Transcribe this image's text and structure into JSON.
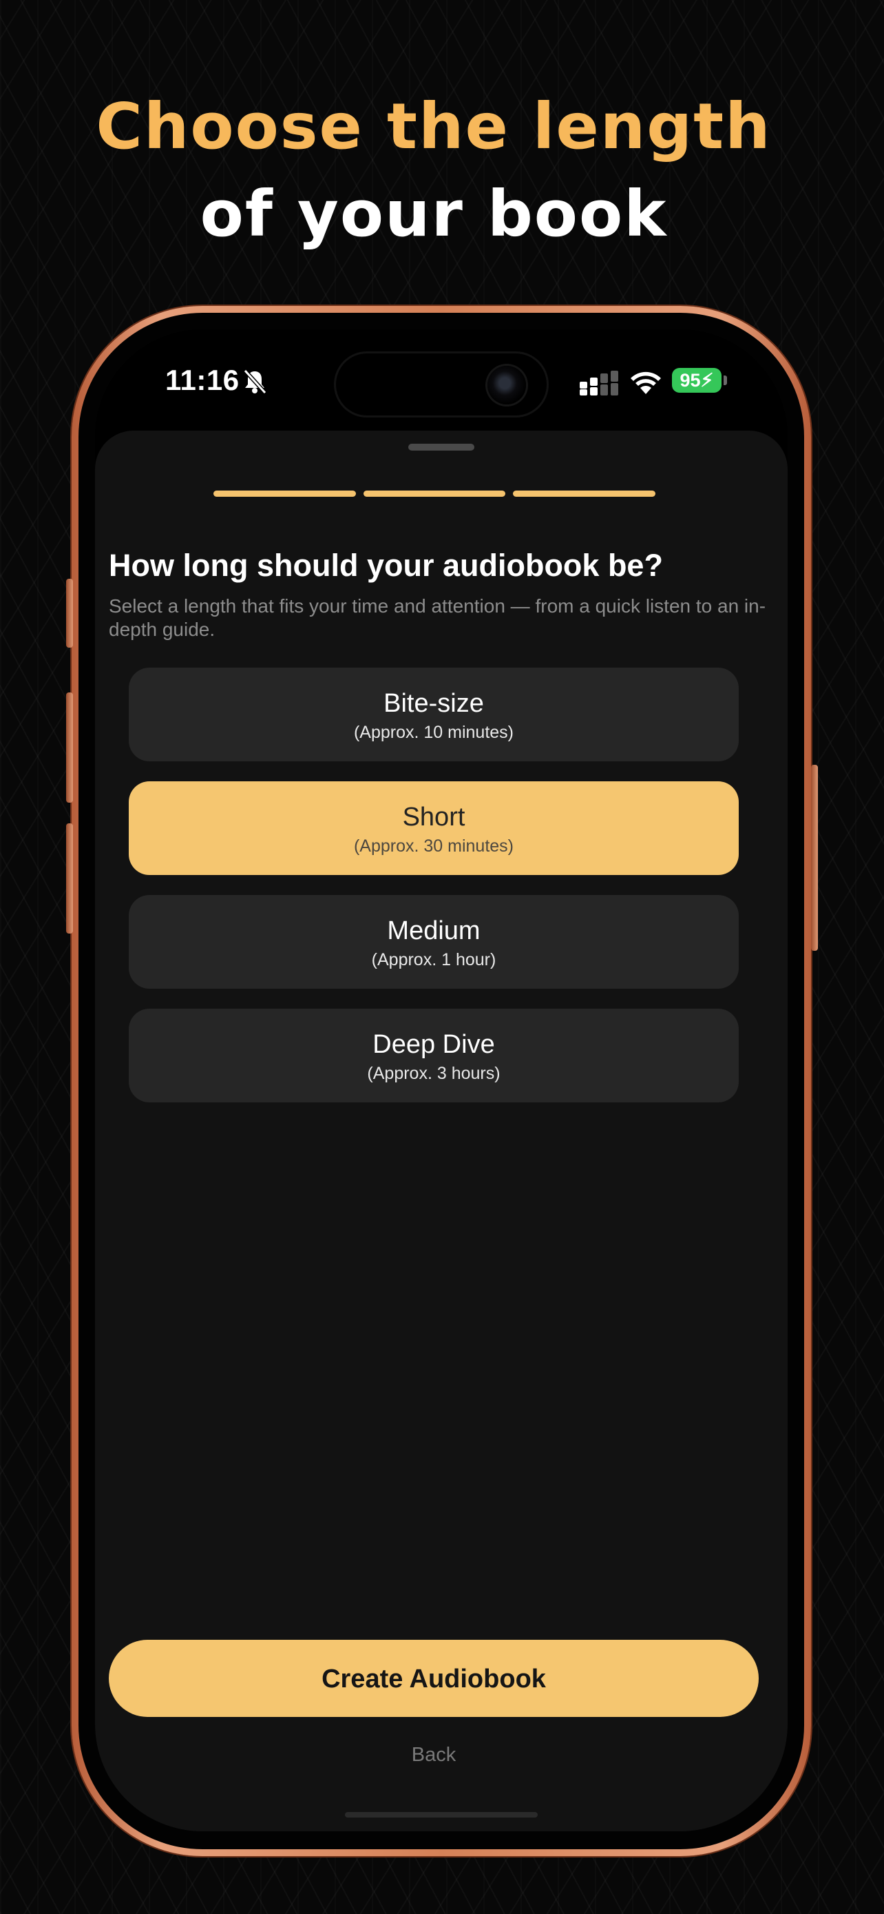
{
  "headline": {
    "line1": "Choose the length",
    "line2": "of your book",
    "line1_color": "#f7b85b",
    "line2_color": "#ffffff"
  },
  "status_bar": {
    "time": "11:16",
    "battery": "95",
    "icons": [
      "bell-slash-icon",
      "signal-icon",
      "wifi-icon",
      "battery-charging-icon"
    ]
  },
  "progress": {
    "segments": 3,
    "completed": 3,
    "color": "#f5c36e"
  },
  "page": {
    "title": "How long should your audiobook be?",
    "subtitle": "Select a length that fits your time and attention — from a quick listen to an in-depth guide."
  },
  "options": [
    {
      "title": "Bite-size",
      "subtitle": "(Approx. 10 minutes)",
      "selected": false
    },
    {
      "title": "Short",
      "subtitle": "(Approx. 30 minutes)",
      "selected": true
    },
    {
      "title": "Medium",
      "subtitle": "(Approx. 1 hour)",
      "selected": false
    },
    {
      "title": "Deep Dive",
      "subtitle": "(Approx. 3 hours)",
      "selected": false
    }
  ],
  "actions": {
    "create_label": "Create Audiobook",
    "back_label": "Back"
  },
  "colors": {
    "accent": "#f5c670",
    "sheet": "#121212",
    "option_bg": "#262626",
    "battery_green": "#35c759"
  }
}
